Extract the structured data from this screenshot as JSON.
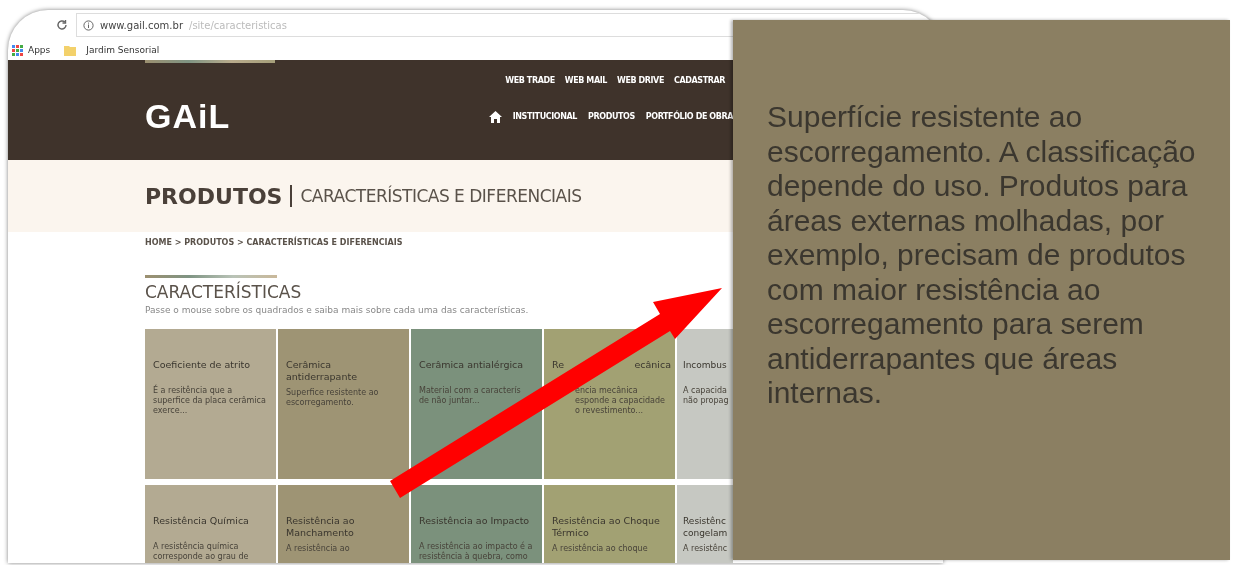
{
  "browser": {
    "url_host": "www.gail.com.br",
    "url_path": "/site/caracteristicas",
    "bookmarks": [
      {
        "label": "Apps",
        "kind": "apps"
      },
      {
        "label": "Jardim Sensorial",
        "kind": "folder"
      }
    ]
  },
  "header": {
    "top_links": [
      "WEB TRADE",
      "WEB MAIL",
      "WEB DRIVE",
      "CADASTRAR"
    ],
    "logo": "GAiL",
    "nav": [
      "INSTITUCIONAL",
      "PRODUTOS",
      "PORTFÓLIO DE OBRA"
    ]
  },
  "banner": {
    "title": "PRODUTOS",
    "subtitle": "CARACTERÍSTICAS E DIFERENCIAIS"
  },
  "breadcrumb": "HOME > PRODUTOS > CARACTERÍSTICAS E DIFERENCIAIS",
  "section": {
    "title": "CARACTERÍSTICAS",
    "intro": "Passe o mouse sobre os quadrados e saiba mais sobre cada uma das características."
  },
  "cards": [
    {
      "kind": "full",
      "title": [
        "Coeficiente de atrito"
      ],
      "description": [
        "É a resitência que a",
        "superfice da placa cerâmica",
        "exerce..."
      ],
      "color": "#b3aa92"
    },
    {
      "kind": "full",
      "title": [
        "Cerâmica",
        "antiderrapante"
      ],
      "description": [
        "Superfice resistente ao",
        "escorregamento."
      ],
      "color": "#9e9474"
    },
    {
      "kind": "full",
      "title": [
        "Cerâmica antialérgica"
      ],
      "description": [
        "Material com a caracterís",
        "de não juntar..."
      ],
      "color": "#7b917c"
    },
    {
      "kind": "covered",
      "title": [
        "Re",
        "ecânica"
      ],
      "description": [
        "ência mecânica",
        "esponde a capacidade",
        "o revestimento..."
      ],
      "color": "#a2a173"
    },
    {
      "kind": "edge",
      "title": [
        "Incombus"
      ],
      "description": [
        "A capacida",
        "não propag"
      ],
      "color": "#c6c8c2"
    },
    {
      "kind": "full",
      "title": [
        "Resistência Química"
      ],
      "description": [
        "A resistência química",
        "corresponde ao grau de"
      ],
      "color": "#b3aa92"
    },
    {
      "kind": "full",
      "title": [
        "Resistência ao",
        "Manchamento"
      ],
      "description": [
        "A resistência ao"
      ],
      "color": "#9e9474"
    },
    {
      "kind": "full",
      "title": [
        "Resistência ao Impacto"
      ],
      "description": [
        "A resistência ao impacto é a",
        "resistência à quebra, como"
      ],
      "color": "#7b917c"
    },
    {
      "kind": "full",
      "title": [
        "Resistência ao Choque",
        "Térmico"
      ],
      "description": [
        "A resistência ao choque"
      ],
      "color": "#a2a173"
    },
    {
      "kind": "edge",
      "title": [
        "Resistênc",
        "congelam"
      ],
      "description": [
        "A resistênc"
      ],
      "color": "#c6c8c2"
    }
  ],
  "callout": {
    "text": "Superfície resistente ao escorregamento. A classificação depende do uso. Produtos para áreas externas molhadas, por exemplo, precisam de produtos com maior resistência ao escorregamento para serem antiderrapantes que áreas internas."
  }
}
